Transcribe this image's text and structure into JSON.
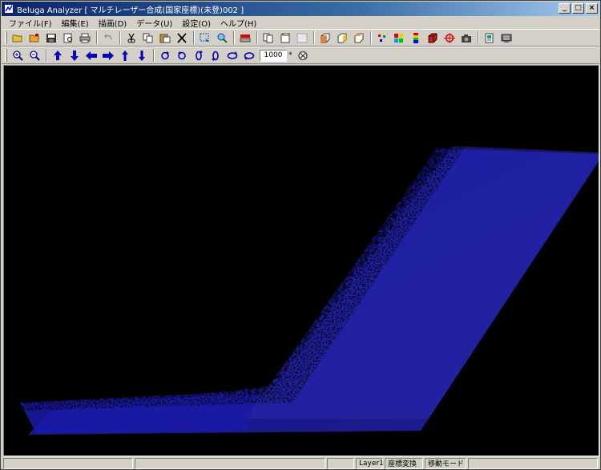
{
  "window": {
    "title": "Beluga Analyzer [ マルチレーザー合成(国家座標)(未登)002 ]",
    "min_label": "_",
    "max_label": "□",
    "close_label": "×"
  },
  "menu": [
    {
      "label": "ファイル(F)"
    },
    {
      "label": "編集(E)"
    },
    {
      "label": "描画(D)"
    },
    {
      "label": "データ(U)"
    },
    {
      "label": "設定(O)"
    },
    {
      "label": "ヘルプ(H)"
    }
  ],
  "toolbar1": {
    "icons": [
      "open-folder-icon",
      "open-folder-alt-icon",
      "save-icon",
      "print-preview-icon",
      "print-icon",
      "undo-icon",
      "cut-icon",
      "copy-icon",
      "paste-icon",
      "delete-icon",
      "select-region-icon",
      "zoom-region-icon",
      "layer-icon",
      "page-new-icon",
      "page-copy-icon",
      "page-blank-icon",
      "cube-orange-icon",
      "cube-yellow-icon",
      "cube-outline-icon",
      "color-points-icon",
      "color-grid-icon",
      "color-scale-icon",
      "cube-red-icon",
      "target-icon",
      "camera-icon",
      "document-icon",
      "monitor-icon"
    ]
  },
  "toolbar2": {
    "zoom_value": "1000",
    "zoom_unit": "*"
  },
  "statusbar": {
    "pane1": "",
    "pane2": "",
    "layer": "Layer1",
    "coord": "座標変換",
    "mode": "移動モード"
  },
  "colors": {
    "titlebar_start": "#0a246a",
    "titlebar_end": "#a6caf0",
    "chrome": "#d4d0c8",
    "viewport_bg": "#000000"
  }
}
